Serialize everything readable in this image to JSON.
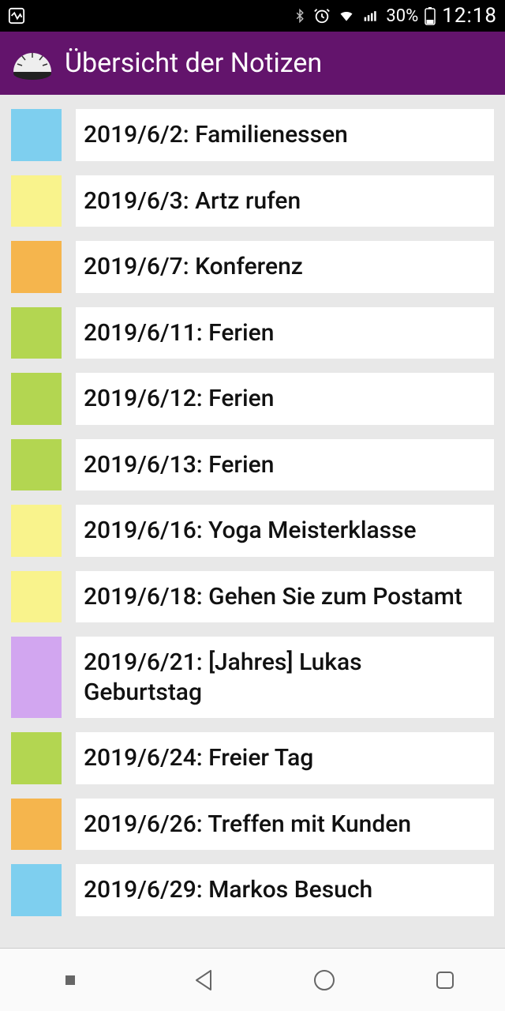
{
  "status": {
    "battery_text": "30%",
    "time": "12:18"
  },
  "header": {
    "title": "Übersicht der Notizen"
  },
  "notes": [
    {
      "color": "c-blue",
      "text": "2019/6/2: Familienessen"
    },
    {
      "color": "c-yellow",
      "text": "2019/6/3: Artz rufen"
    },
    {
      "color": "c-orange",
      "text": "2019/6/7: Konferenz"
    },
    {
      "color": "c-green",
      "text": "2019/6/11: Ferien"
    },
    {
      "color": "c-green",
      "text": "2019/6/12: Ferien"
    },
    {
      "color": "c-green",
      "text": "2019/6/13: Ferien"
    },
    {
      "color": "c-yellow",
      "text": "2019/6/16: Yoga Meisterklasse"
    },
    {
      "color": "c-yellow",
      "text": "2019/6/18: Gehen Sie zum Postamt"
    },
    {
      "color": "c-purple",
      "text": "2019/6/21: [Jahres] Lukas Geburtstag"
    },
    {
      "color": "c-green",
      "text": "2019/6/24: Freier Tag"
    },
    {
      "color": "c-orange",
      "text": "2019/6/26: Treffen mit Kunden"
    },
    {
      "color": "c-blue",
      "text": "2019/6/29: Markos Besuch"
    }
  ]
}
